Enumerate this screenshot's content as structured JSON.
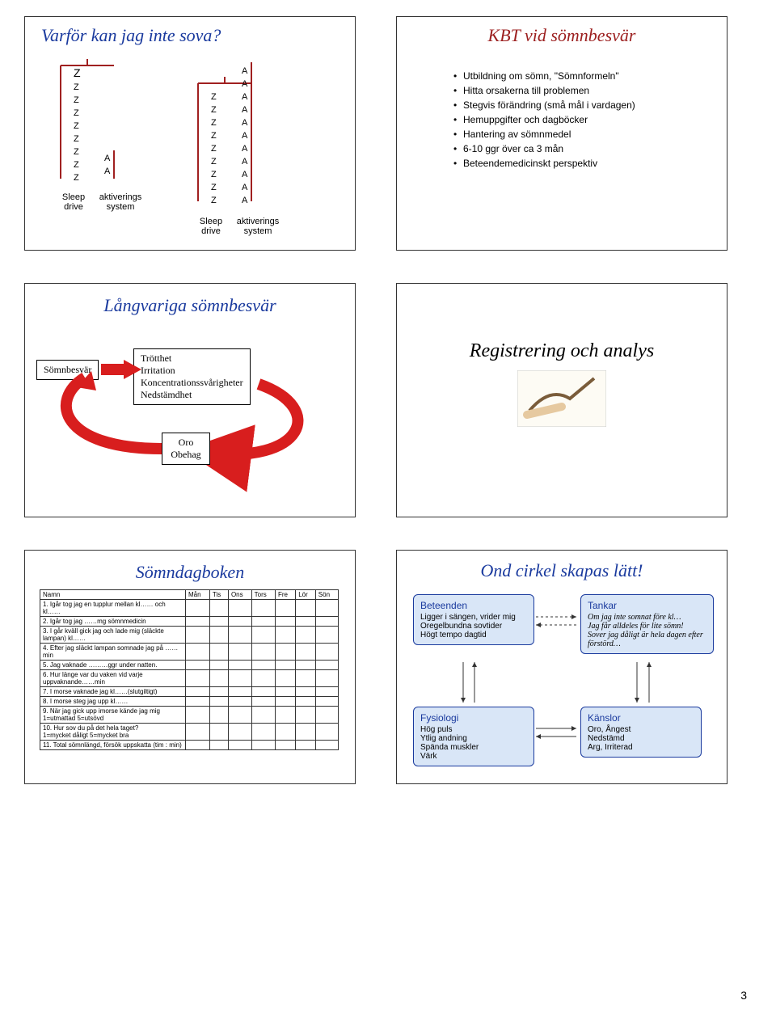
{
  "page_number": "3",
  "slide1": {
    "title": "Varför kan jag inte sova?",
    "labels": {
      "sleep": "Sleep\ndrive",
      "act": "aktiverings\nsystem"
    }
  },
  "slide2": {
    "title": "KBT vid sömnbesvär",
    "bullets": [
      "Utbildning om sömn, \"Sömnformeln\"",
      "Hitta orsakerna till problemen",
      "Stegvis förändring (små mål i vardagen)",
      "Hemuppgifter och dagböcker",
      "Hantering av sömnmedel",
      "6-10 ggr över ca 3 mån",
      "Beteendemedicinskt perspektiv"
    ]
  },
  "slide3": {
    "title": "Långvariga sömnbesvär",
    "box1": "Sömnbesvär",
    "box2": "Trötthet\nIrritation\nKoncentrationssvårigheter\nNedstämdhet",
    "box3": "Oro\nObehag"
  },
  "slide4": {
    "title": "Registrering och analys"
  },
  "slide5": {
    "title": "Sömndagboken",
    "headers": [
      "Namn",
      "Mån",
      "Tis",
      "Ons",
      "Tors",
      "Fre",
      "Lör",
      "Sön"
    ],
    "rows": [
      "1. Igår tog jag en tupplur mellan kl…… och kl……",
      "2. Igår tog jag ……mg sömnmedicin",
      "3. I går kväll gick jag och lade mig (släckte lampan) kl……",
      "4. Efter jag släckt lampan somnade jag på ……min",
      "5. Jag vaknade ………ggr under natten.",
      "6. Hur länge var du vaken vid varje uppvaknande……min",
      "7. I morse vaknade jag kl……(slutgiltigt)",
      "8. I morse steg jag upp kl……",
      "9. När jag gick upp imorse kände jag mig\n    1=utmattad   5=utsövd",
      "10. Hur sov du på det hela taget?\n    1=mycket dåligt   5=mycket bra",
      "11. Total sömnlängd, försök uppskatta  (tim : min)"
    ]
  },
  "slide6": {
    "title": "Ond cirkel skapas lätt!",
    "boxes": {
      "beteenden": {
        "title": "Beteenden",
        "body": "Ligger i sängen, vrider mig\nOregelbundna sovtider\nHögt tempo dagtid"
      },
      "tankar": {
        "title": "Tankar",
        "body": "Om jag inte somnat före kl…\nJag får alldeles för lite sömn!\nSover jag dåligt är hela dagen efter förstörd…"
      },
      "fysiologi": {
        "title": "Fysiologi",
        "body": "Hög puls\nYtlig andning\nSpända muskler\nVärk"
      },
      "kanslor": {
        "title": "Känslor",
        "body": "Oro, Ångest\nNedstämd\nArg, Irriterad"
      }
    }
  }
}
